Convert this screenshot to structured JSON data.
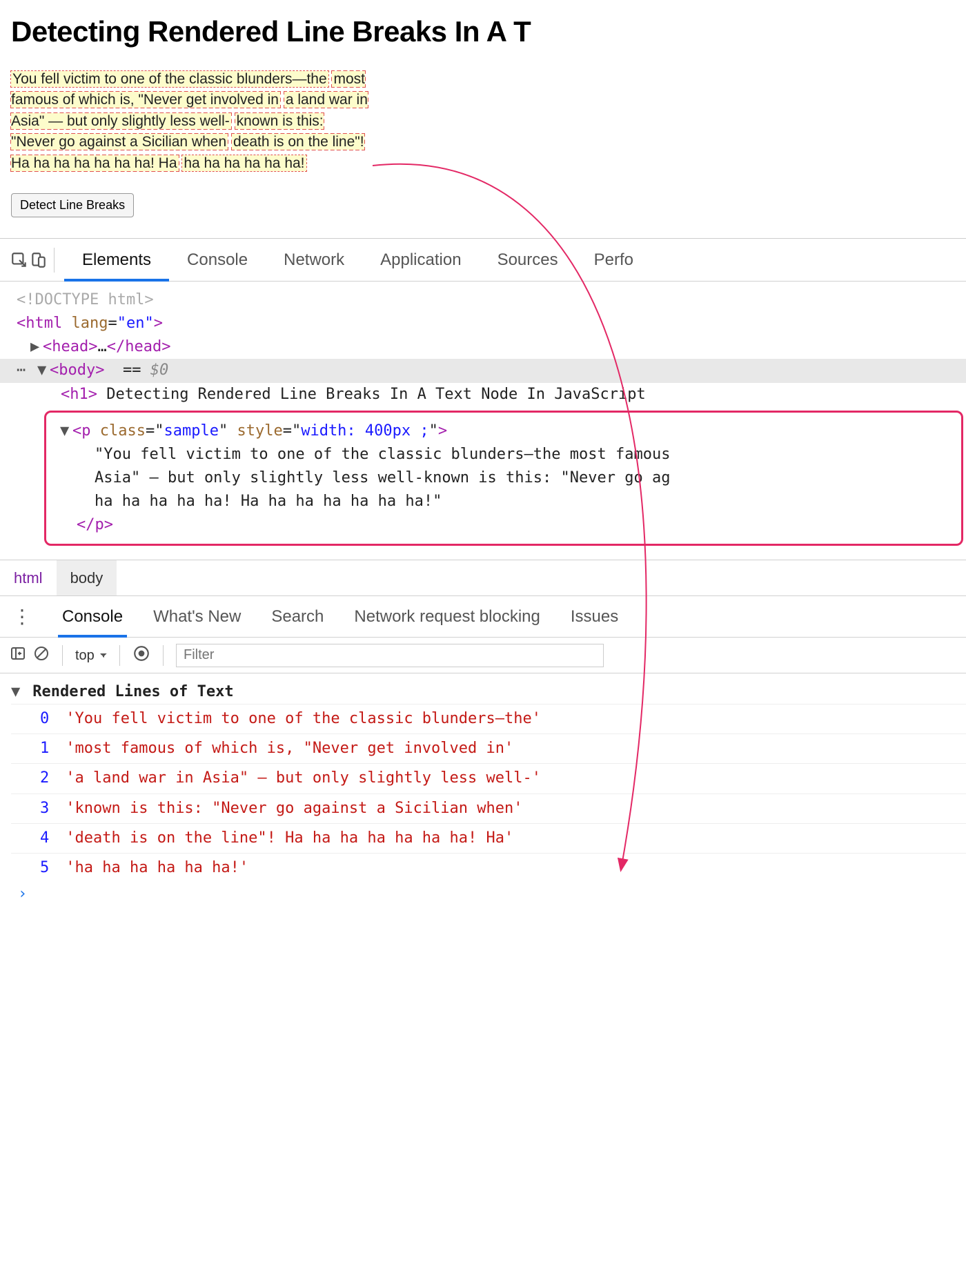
{
  "title": "Detecting Rendered Line Breaks In A T",
  "sample_lines": [
    "You fell victim to one of the classic blunders—the",
    "most famous of which is, \"Never get involved in",
    "a land war in Asia\" — but only slightly less well-",
    "known is this: \"Never go against a Sicilian when",
    "death is on the line\"! Ha ha ha ha ha ha ha! Ha",
    "ha ha ha ha ha ha!"
  ],
  "button_label": "Detect Line Breaks",
  "devtools": {
    "tabs": [
      "Elements",
      "Console",
      "Network",
      "Application",
      "Sources",
      "Perfo"
    ],
    "active_tab": "Elements",
    "dom": {
      "doctype": "<!DOCTYPE html>",
      "html_open": "<html lang=\"en\">",
      "head": "<head>…</head>",
      "body_row": "<body> == $0",
      "h1_text": "Detecting Rendered Line Breaks In A Text Node In JavaScript",
      "p_open_class": "sample",
      "p_open_style": "width: 400px ;",
      "p_text_lines": [
        "\"You fell victim to one of the classic blunders—the most famous",
        "Asia\" — but only slightly less well-known is this: \"Never go ag",
        "ha ha ha ha ha! Ha ha ha ha ha ha ha!\""
      ],
      "p_close": "</p>"
    },
    "breadcrumb": [
      "html",
      "body"
    ],
    "drawer_tabs": [
      "Console",
      "What's New",
      "Search",
      "Network request blocking",
      "Issues"
    ],
    "drawer_active": "Console",
    "console_toolbar": {
      "context": "top",
      "filter_placeholder": "Filter"
    },
    "console": {
      "group": "Rendered Lines of Text",
      "lines": [
        "'You fell victim to one of the classic blunders—the'",
        "'most famous of which is, \"Never get involved in'",
        "'a land war in Asia\" — but only slightly less well-'",
        "'known is this: \"Never go against a Sicilian when'",
        "'death is on the line\"! Ha ha ha ha ha ha ha! Ha'",
        "'ha ha ha ha ha ha!'"
      ]
    }
  }
}
